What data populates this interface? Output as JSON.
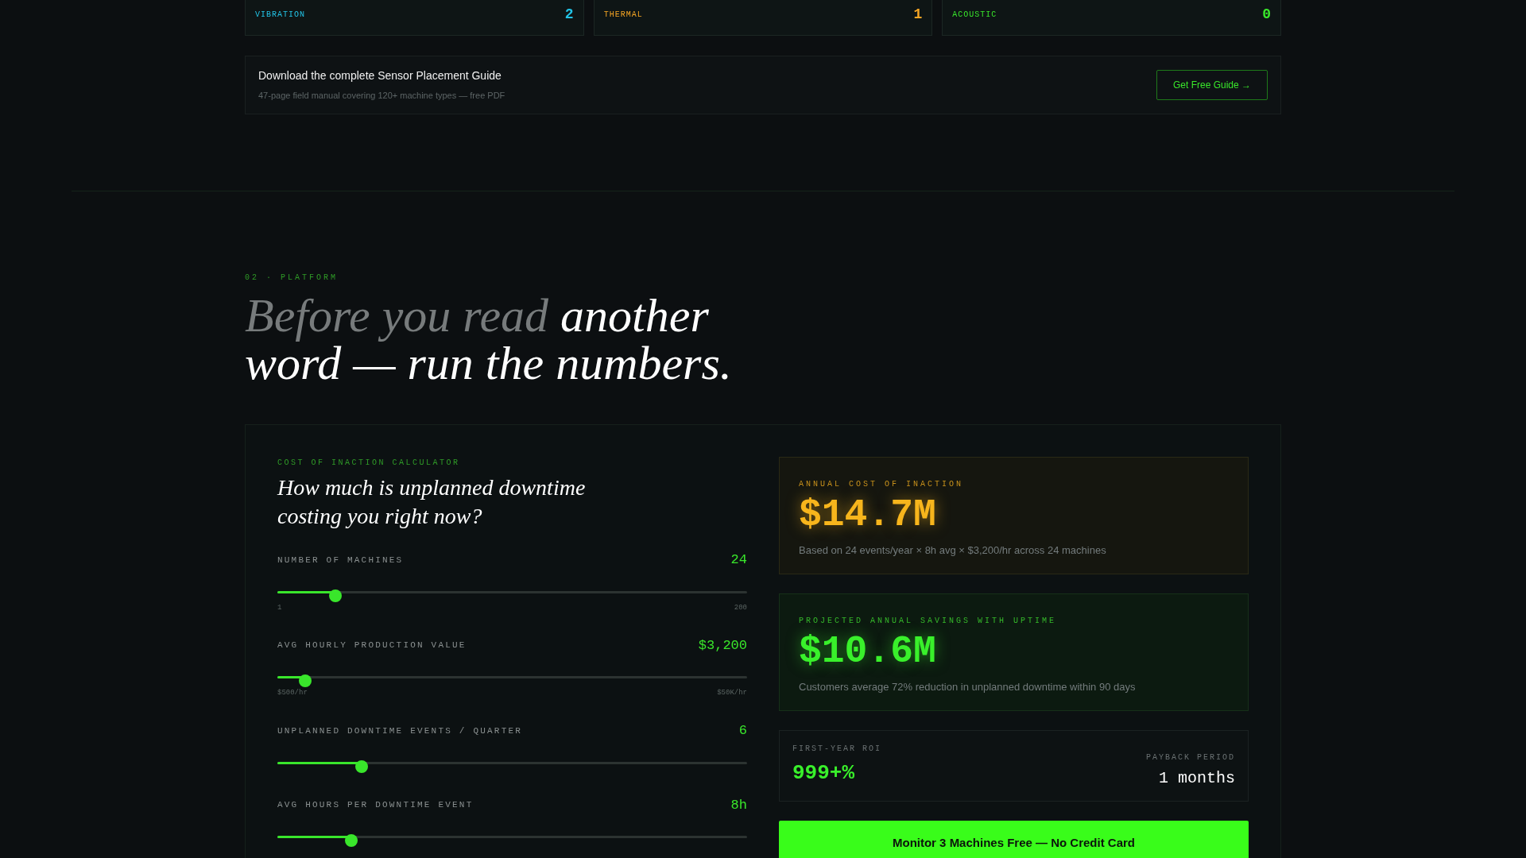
{
  "sensor_counts": [
    {
      "label": "VIBRATION",
      "count": "2",
      "color": "#22c3e6"
    },
    {
      "label": "THERMAL",
      "count": "1",
      "color": "#f5a524"
    },
    {
      "label": "ACOUSTIC",
      "count": "0",
      "color": "#39e62b"
    }
  ],
  "guide_banner": {
    "title": "Download the complete Sensor Placement Guide",
    "subtitle": "47-page field manual covering 120+ machine types — free PDF",
    "button": "Get Free Guide →"
  },
  "section": {
    "eyebrow": "02 · PLATFORM",
    "headline": {
      "muted": "Before you read",
      "main": "another word — run the numbers."
    }
  },
  "calculator": {
    "eyebrow": "COST OF INACTION CALCULATOR",
    "title": "How much is unplanned downtime costing you right now?",
    "sliders": [
      {
        "label": "NUMBER OF MACHINES",
        "reading": "24",
        "level": 0.124,
        "min": "1",
        "max": "200"
      },
      {
        "label": "AVG HOURLY PRODUCTION VALUE",
        "reading": "$3,200",
        "level": 0.06,
        "min": "$500/hr",
        "max": "$50K/hr"
      },
      {
        "label": "UNPLANNED DOWNTIME EVENTS / QUARTER",
        "reading": "6",
        "level": 0.18
      },
      {
        "label": "AVG HOURS PER DOWNTIME EVENT",
        "reading": "8h",
        "level": 0.157
      }
    ],
    "results": [
      {
        "kind": "cost",
        "label": "ANNUAL COST OF INACTION",
        "value": "$14.7M",
        "note": "Based on 24 events/year × 8h avg × $3,200/hr across 24 machines"
      },
      {
        "kind": "savings",
        "label": "PROJECTED ANNUAL SAVINGS WITH UPTIME",
        "value": "$10.6M",
        "note": "Customers average 72% reduction in unplanned downtime within 90 days"
      }
    ],
    "roi": {
      "label": "FIRST-YEAR ROI",
      "value": "999+%"
    },
    "payback": {
      "label": "PAYBACK PERIOD",
      "value": "1 months"
    },
    "cta": "Monitor 3 Machines Free — No Credit Card"
  }
}
